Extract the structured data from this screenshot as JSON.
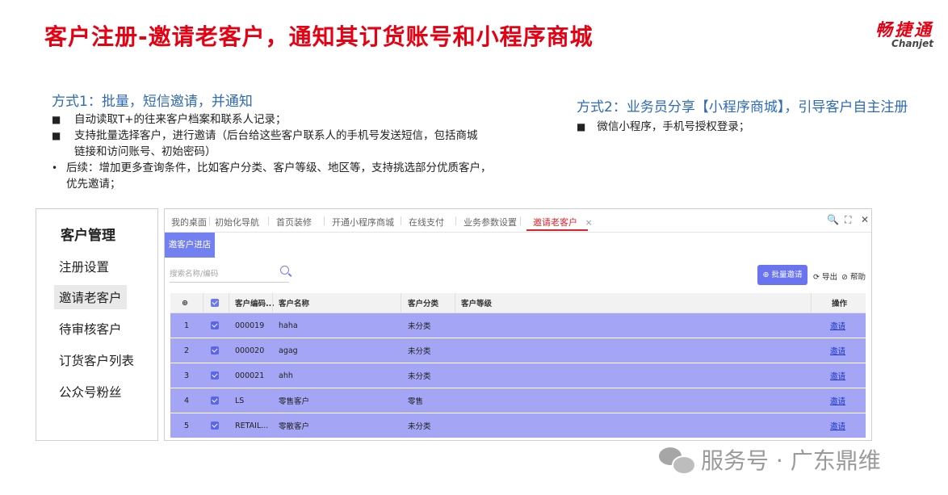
{
  "title": "客户注册-邀请老客户，通知其订货账号和小程序商城",
  "logo": {
    "cn": "畅捷通",
    "en": "Chanjet"
  },
  "method1": {
    "title": "方式1：批量，短信邀请，并通知",
    "items": [
      "自动读取T+的往来客户档案和联系人记录；",
      "支持批量选择客户，进行邀请（后台给这些客户联系人的手机号发送短信，包括商城",
      "链接和访问账号、初始密码）",
      "后续：增加更多查询条件，比如客户分类、客户等级、地区等，支持挑选部分优质客户，",
      "优先邀请；"
    ],
    "bullets": {
      "square": "■",
      "dot": "•"
    }
  },
  "method2": {
    "title": "方式2：业务员分享【小程序商城】，引导客户自主注册",
    "items": [
      "微信小程序，手机号授权登录；"
    ]
  },
  "sidebar": {
    "header": "客户管理",
    "items": [
      "注册设置",
      "邀请老客户",
      "待审核客户",
      "订货客户列表",
      "公众号粉丝"
    ],
    "active_index": 1
  },
  "app": {
    "tabs": [
      "我的桌面",
      "初始化导航",
      "首页装修",
      "开通小程序商城",
      "在线支付",
      "业务参数设置",
      "邀请老客户"
    ],
    "active_tab_close": "×",
    "toolbar_icons": {
      "search": "🔍",
      "fullscreen": "⛶",
      "close": "✕"
    },
    "subtab": "邀客户进店",
    "search_placeholder": "搜索名称/编码",
    "batch_invite": "⊕ 批量邀请",
    "export": "⟳ 导出",
    "help": "⊘ 帮助",
    "columns": {
      "settings": "⊛",
      "code": "客户编码...",
      "name": "客户名称",
      "category": "客户分类",
      "level": "客户等级",
      "action": "操作"
    },
    "rows": [
      {
        "no": "1",
        "code": "000019",
        "name": "haha",
        "category": "未分类",
        "level": "",
        "action": "邀请"
      },
      {
        "no": "2",
        "code": "000020",
        "name": "agag",
        "category": "未分类",
        "level": "",
        "action": "邀请"
      },
      {
        "no": "3",
        "code": "000021",
        "name": "ahh",
        "category": "未分类",
        "level": "",
        "action": "邀请"
      },
      {
        "no": "4",
        "code": "LS",
        "name": "零售客户",
        "category": "零售",
        "level": "",
        "action": "邀请"
      },
      {
        "no": "5",
        "code": "RETAIL...",
        "name": "零散客户",
        "category": "未分类",
        "level": "",
        "action": "邀请"
      }
    ]
  },
  "watermark": "服务号 · 广东鼎维",
  "colors": {
    "title_red": "#e60012",
    "method_blue": "#2e6ab8",
    "row_purple": "#a4a6f5",
    "button_purple": "#6a74f0"
  }
}
